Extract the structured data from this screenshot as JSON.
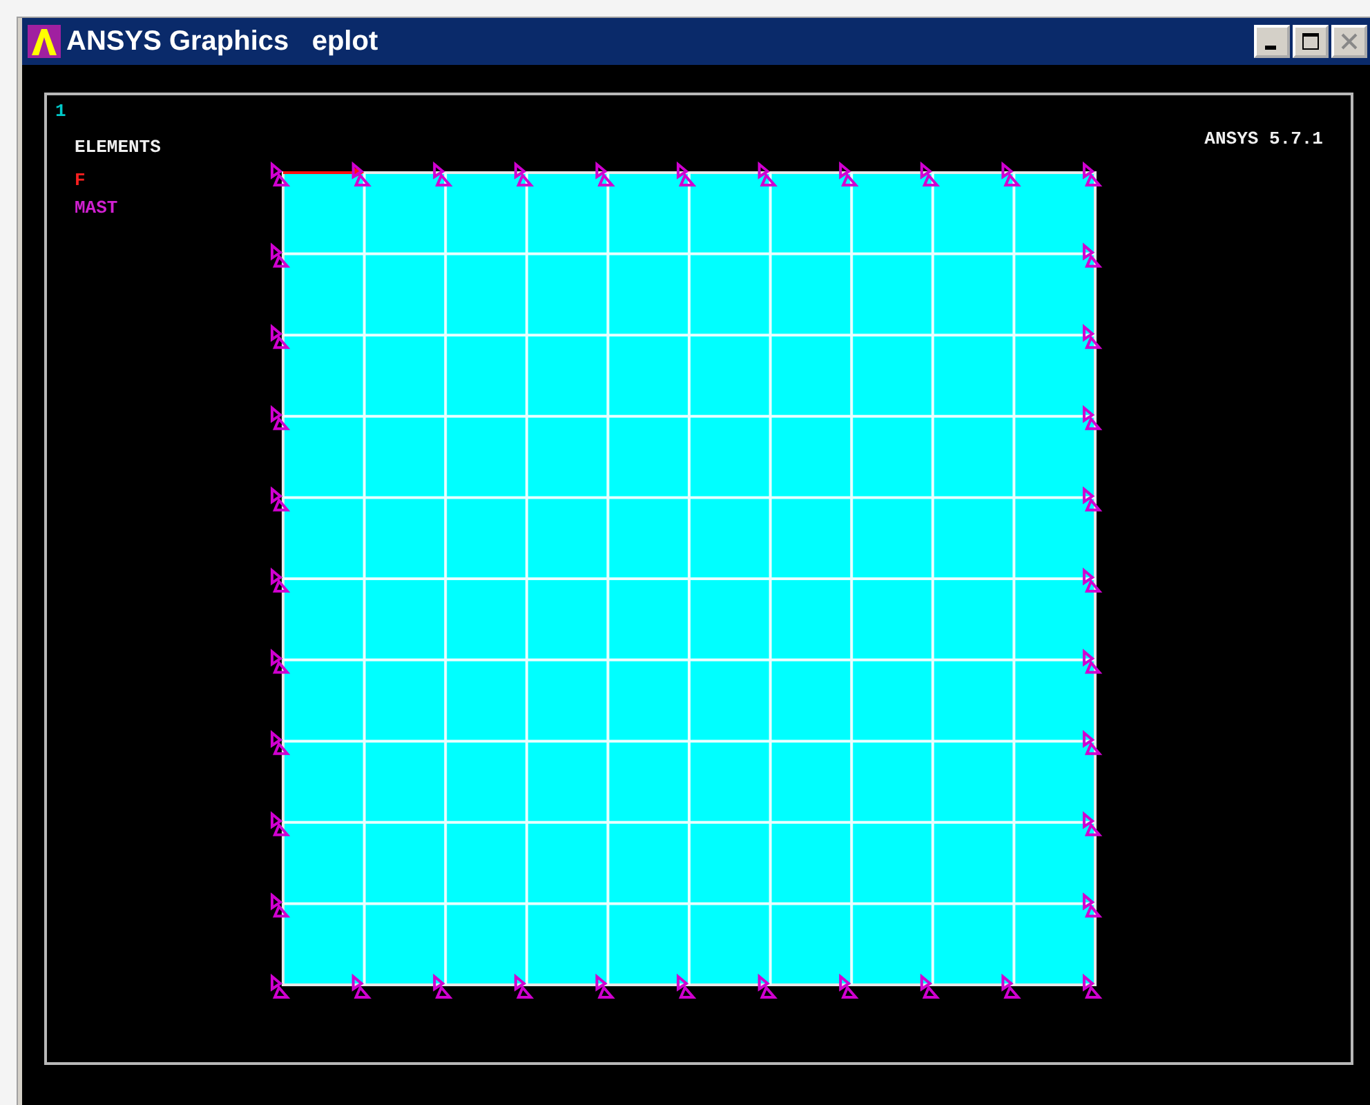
{
  "window": {
    "title": "ANSYS Graphics   eplot"
  },
  "legend": [
    {
      "text": "1",
      "color": "#00c8c8"
    },
    {
      "text": "ELEMENTS",
      "color": "#f0f0f0"
    },
    {
      "text": "F",
      "color": "#ff2020"
    },
    {
      "text": "MAST",
      "color": "#d020d0"
    }
  ],
  "version": "ANSYS 5.7.1"
}
